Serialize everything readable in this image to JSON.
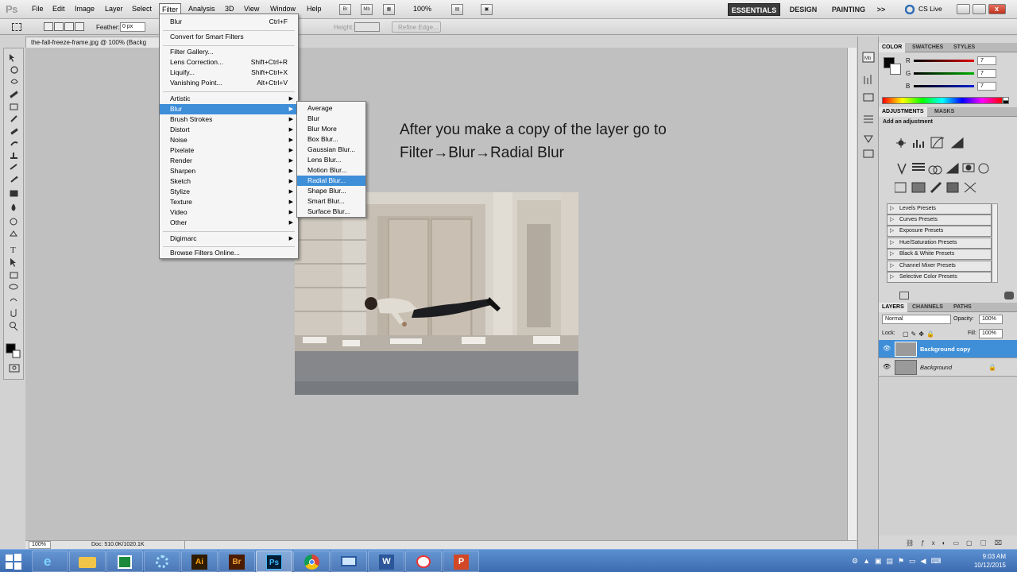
{
  "app": {
    "logo": "Ps"
  },
  "menubar": {
    "items": [
      "File",
      "Edit",
      "Image",
      "Layer",
      "Select",
      "Filter",
      "Analysis",
      "3D",
      "View",
      "Window",
      "Help"
    ],
    "zoom": "100%",
    "workspaces": [
      "ESSENTIALS",
      "DESIGN",
      "PAINTING"
    ],
    "more": ">>",
    "cslive": "CS Live"
  },
  "options": {
    "feather_label": "Feather:",
    "feather_value": "0 px",
    "height_label": "Height:",
    "refine_edge": "Refine Edge..."
  },
  "document": {
    "tab_title": "the-fall-freeze-frame.jpg @ 100% (Backg",
    "zoom": "100%",
    "doc_size": "Doc: 510.0K/1020.1K"
  },
  "annotation": {
    "line1": "After you make a copy of the layer go to",
    "line2_a": "Filter",
    "line2_b": "Blur",
    "line2_c": "Radial Blur"
  },
  "filter_menu": {
    "blur_last": "Blur",
    "blur_last_sc": "Ctrl+F",
    "convert": "Convert for Smart Filters",
    "gallery": "Filter Gallery...",
    "lens": "Lens Correction...",
    "lens_sc": "Shift+Ctrl+R",
    "liquify": "Liquify...",
    "liquify_sc": "Shift+Ctrl+X",
    "vanishing": "Vanishing Point...",
    "vanishing_sc": "Alt+Ctrl+V",
    "groups": [
      "Artistic",
      "Blur",
      "Brush Strokes",
      "Distort",
      "Noise",
      "Pixelate",
      "Render",
      "Sharpen",
      "Sketch",
      "Stylize",
      "Texture",
      "Video",
      "Other"
    ],
    "digimarc": "Digimarc",
    "browse": "Browse Filters Online..."
  },
  "blur_submenu": [
    "Average",
    "Blur",
    "Blur More",
    "Box Blur...",
    "Gaussian Blur...",
    "Lens Blur...",
    "Motion Blur...",
    "Radial Blur...",
    "Shape Blur...",
    "Smart Blur...",
    "Surface Blur..."
  ],
  "color_panel": {
    "tabs": [
      "COLOR",
      "SWATCHES",
      "STYLES"
    ],
    "r_label": "R",
    "g_label": "G",
    "b_label": "B",
    "r": "7",
    "g": "7",
    "b": "7"
  },
  "adjustments": {
    "tabs": [
      "ADJUSTMENTS",
      "MASKS"
    ],
    "heading": "Add an adjustment",
    "presets": [
      "Levels Presets",
      "Curves Presets",
      "Exposure Presets",
      "Hue/Saturation Presets",
      "Black & White Presets",
      "Channel Mixer Presets",
      "Selective Color Presets"
    ]
  },
  "layers": {
    "tabs": [
      "LAYERS",
      "CHANNELS",
      "PATHS"
    ],
    "blend_mode": "Normal",
    "opacity_label": "Opacity:",
    "opacity": "100%",
    "lock_label": "Lock:",
    "fill_label": "Fill:",
    "fill": "100%",
    "items": [
      {
        "name": "Background copy"
      },
      {
        "name": "Background"
      }
    ]
  },
  "taskbar": {
    "time": "9:03 AM",
    "date": "10/12/2015"
  },
  "colors": {
    "highlight": "#3e8ed8",
    "canvas": "#c0c0c0",
    "taskbar": "#4a7cc0"
  }
}
